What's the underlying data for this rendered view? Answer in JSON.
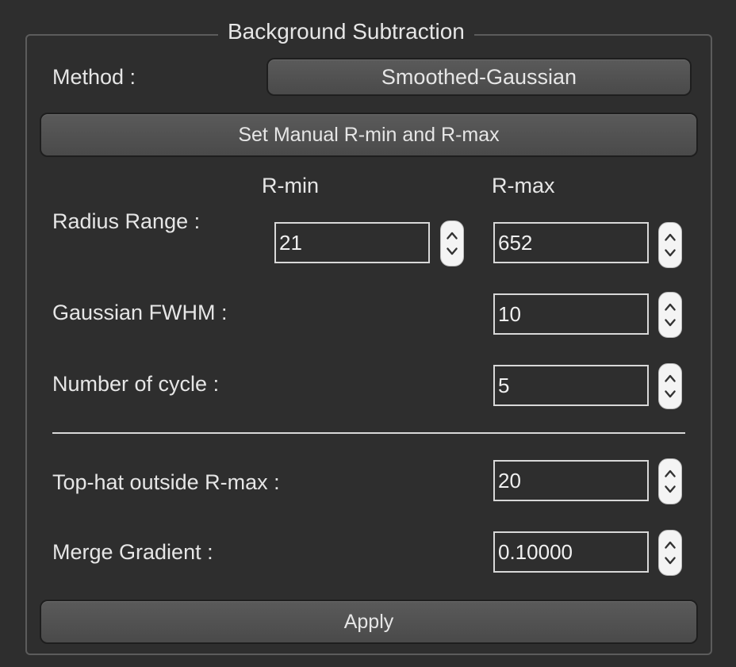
{
  "group": {
    "title": "Background Subtraction"
  },
  "method": {
    "label": "Method :",
    "value": "Smoothed-Gaussian"
  },
  "manual_button": {
    "label": "Set Manual R-min and R-max"
  },
  "radius": {
    "label": "Radius Range :",
    "rmin_header": "R-min",
    "rmax_header": "R-max",
    "rmin_value": "21",
    "rmax_value": "652"
  },
  "gaussian_fwhm": {
    "label": "Gaussian FWHM :",
    "value": "10"
  },
  "cycles": {
    "label": "Number of cycle :",
    "value": "5"
  },
  "tophat": {
    "label": "Top-hat outside R-max :",
    "value": "20"
  },
  "merge_gradient": {
    "label": "Merge Gradient :",
    "value": "0.10000"
  },
  "apply_button": {
    "label": "Apply"
  },
  "icons": {
    "spin": "up-down-arrows-icon"
  }
}
